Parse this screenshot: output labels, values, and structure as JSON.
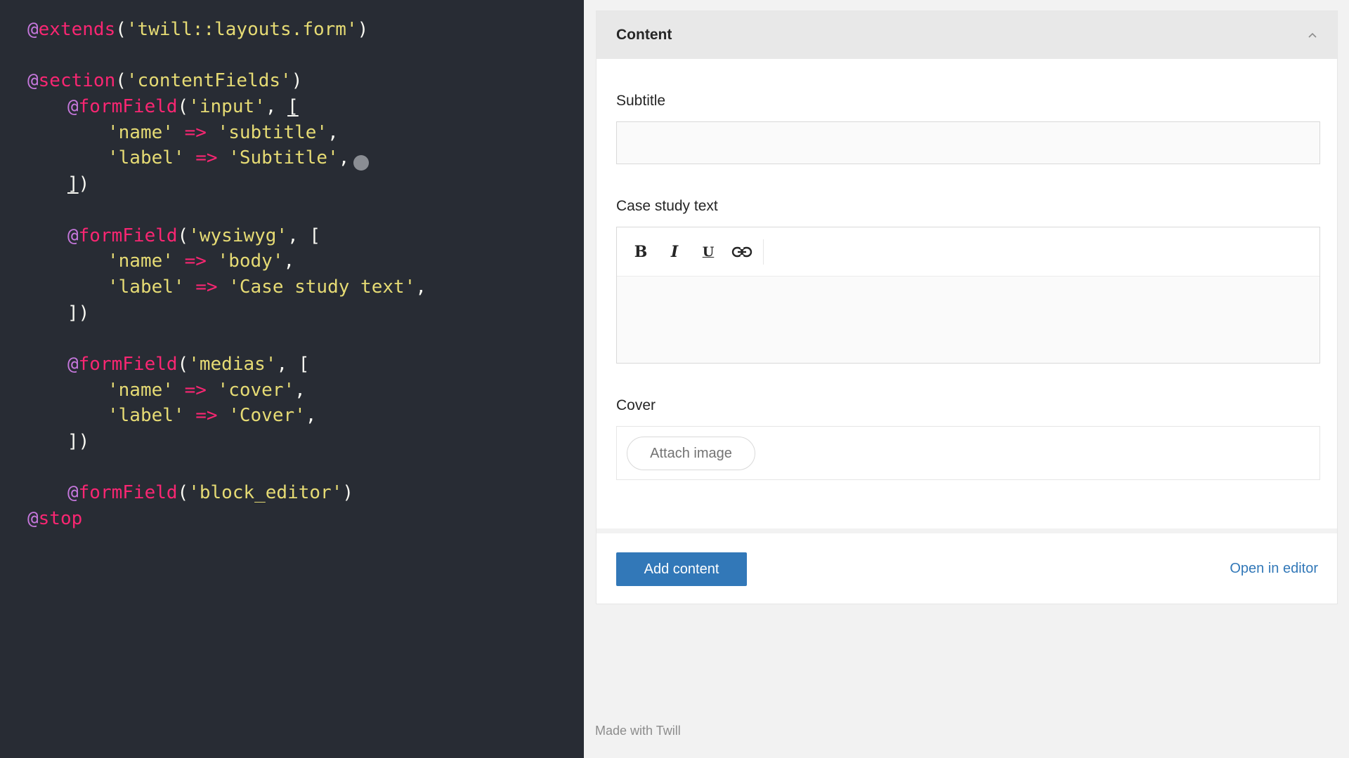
{
  "code_editor": {
    "lines": [
      [
        {
          "t": "at",
          "v": "@"
        },
        {
          "t": "dir",
          "v": "extends"
        },
        {
          "t": "punc",
          "v": "("
        },
        {
          "t": "str",
          "v": "'twill::layouts.form'"
        },
        {
          "t": "punc",
          "v": ")"
        }
      ],
      [],
      [
        {
          "t": "at",
          "v": "@"
        },
        {
          "t": "dir",
          "v": "section"
        },
        {
          "t": "punc",
          "v": "("
        },
        {
          "t": "str",
          "v": "'contentFields'"
        },
        {
          "t": "punc",
          "v": ")"
        }
      ],
      [
        {
          "t": "at",
          "v": "@"
        },
        {
          "t": "dir",
          "v": "formField"
        },
        {
          "t": "punc",
          "v": "("
        },
        {
          "t": "str",
          "v": "'input'"
        },
        {
          "t": "punc",
          "v": ", "
        },
        {
          "t": "punc",
          "v": "[",
          "u": true
        }
      ],
      [
        {
          "t": "str",
          "v": "'name'"
        },
        {
          "t": "punc",
          "v": " "
        },
        {
          "t": "op",
          "v": "=>"
        },
        {
          "t": "punc",
          "v": " "
        },
        {
          "t": "str",
          "v": "'subtitle'"
        },
        {
          "t": "punc",
          "v": ","
        }
      ],
      [
        {
          "t": "str",
          "v": "'label'"
        },
        {
          "t": "punc",
          "v": " "
        },
        {
          "t": "op",
          "v": "=>"
        },
        {
          "t": "punc",
          "v": " "
        },
        {
          "t": "str",
          "v": "'Subtitle'"
        },
        {
          "t": "punc",
          "v": ","
        }
      ],
      [
        {
          "t": "punc",
          "v": "]",
          "u": true
        },
        {
          "t": "punc",
          "v": ")"
        }
      ],
      [],
      [
        {
          "t": "at",
          "v": "@"
        },
        {
          "t": "dir",
          "v": "formField"
        },
        {
          "t": "punc",
          "v": "("
        },
        {
          "t": "str",
          "v": "'wysiwyg'"
        },
        {
          "t": "punc",
          "v": ", ["
        }
      ],
      [
        {
          "t": "str",
          "v": "'name'"
        },
        {
          "t": "punc",
          "v": " "
        },
        {
          "t": "op",
          "v": "=>"
        },
        {
          "t": "punc",
          "v": " "
        },
        {
          "t": "str",
          "v": "'body'"
        },
        {
          "t": "punc",
          "v": ","
        }
      ],
      [
        {
          "t": "str",
          "v": "'label'"
        },
        {
          "t": "punc",
          "v": " "
        },
        {
          "t": "op",
          "v": "=>"
        },
        {
          "t": "punc",
          "v": " "
        },
        {
          "t": "str",
          "v": "'Case study text'"
        },
        {
          "t": "punc",
          "v": ","
        }
      ],
      [
        {
          "t": "punc",
          "v": "])"
        }
      ],
      [],
      [
        {
          "t": "at",
          "v": "@"
        },
        {
          "t": "dir",
          "v": "formField"
        },
        {
          "t": "punc",
          "v": "("
        },
        {
          "t": "str",
          "v": "'medias'"
        },
        {
          "t": "punc",
          "v": ", ["
        }
      ],
      [
        {
          "t": "str",
          "v": "'name'"
        },
        {
          "t": "punc",
          "v": " "
        },
        {
          "t": "op",
          "v": "=>"
        },
        {
          "t": "punc",
          "v": " "
        },
        {
          "t": "str",
          "v": "'cover'"
        },
        {
          "t": "punc",
          "v": ","
        }
      ],
      [
        {
          "t": "str",
          "v": "'label'"
        },
        {
          "t": "punc",
          "v": " "
        },
        {
          "t": "op",
          "v": "=>"
        },
        {
          "t": "punc",
          "v": " "
        },
        {
          "t": "str",
          "v": "'Cover'"
        },
        {
          "t": "punc",
          "v": ","
        }
      ],
      [
        {
          "t": "punc",
          "v": "])"
        }
      ],
      [],
      [
        {
          "t": "at",
          "v": "@"
        },
        {
          "t": "dir",
          "v": "formField"
        },
        {
          "t": "punc",
          "v": "("
        },
        {
          "t": "str",
          "v": "'block_editor'"
        },
        {
          "t": "punc",
          "v": ")"
        }
      ],
      [
        {
          "t": "at",
          "v": "@"
        },
        {
          "t": "dir",
          "v": "stop"
        }
      ]
    ],
    "indents": [
      0,
      0,
      0,
      1,
      2,
      2,
      1,
      0,
      1,
      2,
      2,
      1,
      0,
      1,
      2,
      2,
      1,
      0,
      1,
      0
    ]
  },
  "preview": {
    "card_title": "Content",
    "collapse_icon": "chevron-up-icon",
    "subtitle_label": "Subtitle",
    "subtitle_value": "",
    "wysiwyg_label": "Case study text",
    "toolbar": {
      "bold": "B",
      "italic": "I",
      "underline": "U",
      "link_icon": "link-icon"
    },
    "cover_label": "Cover",
    "attach_button": "Attach image",
    "add_content_button": "Add content",
    "open_editor_link": "Open in editor",
    "footer": "Made with Twill"
  },
  "colors": {
    "editor_bg": "#282c34",
    "accent_blue": "#3278b8",
    "code_string": "#e6db74",
    "code_directive": "#f92672",
    "code_at": "#c678dd"
  }
}
